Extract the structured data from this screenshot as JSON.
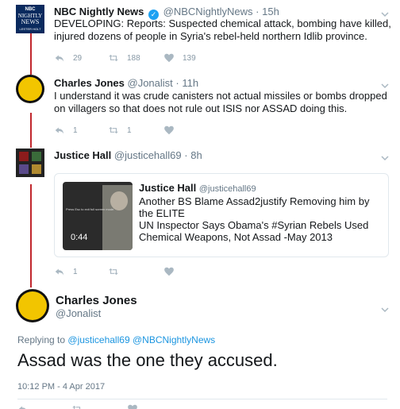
{
  "tweets": [
    {
      "name": "NBC Nightly News",
      "handle": "@NBCNightlyNews",
      "time": "15h",
      "text": "DEVELOPING: Reports: Suspected chemical attack, bombing have killed, injured dozens of people in Syria's rebel-held northern Idlib province.",
      "reply_count": "29",
      "retweet_count": "188",
      "like_count": "139",
      "avatar_text": [
        "NBC",
        "NIGHTLY",
        "NEWS",
        "LESTER HOLT"
      ]
    },
    {
      "name": "Charles Jones",
      "handle": "@Jonalist",
      "time": "11h",
      "text": "I understand it was crude canisters not actual missiles or bombs dropped on villagers so that does not rule out ISIS nor ASSAD doing this.",
      "reply_count": "1",
      "retweet_count": "1",
      "like_count": ""
    },
    {
      "name": "Justice Hall",
      "handle": "@justicehall69",
      "time": "8h",
      "reply_count": "1",
      "retweet_count": "",
      "like_count": "",
      "quote": {
        "name": "Justice Hall",
        "handle": "@justicehall69",
        "text": "Another BS Blame Assad2justify Removing him by the ELITE\nUN Inspector Says Obama's #Syrian Rebels Used Chemical Weapons, Not Assad -May 2013",
        "video_time": "0:44",
        "video_overlay": "Press Esc to exit full screen mode."
      }
    }
  ],
  "main_tweet": {
    "name": "Charles Jones",
    "handle": "@Jonalist",
    "replying_prefix": "Replying to",
    "reply_to_1": "@justicehall69",
    "reply_to_2": "@NBCNightlyNews",
    "text": "Assad was the one they accused.",
    "timestamp": "10:12 PM - 4 Apr 2017"
  },
  "colors": {
    "thread_line": "#c1272d",
    "link": "#1b95e0",
    "meta": "#657786",
    "icon": "#aab8c2"
  }
}
